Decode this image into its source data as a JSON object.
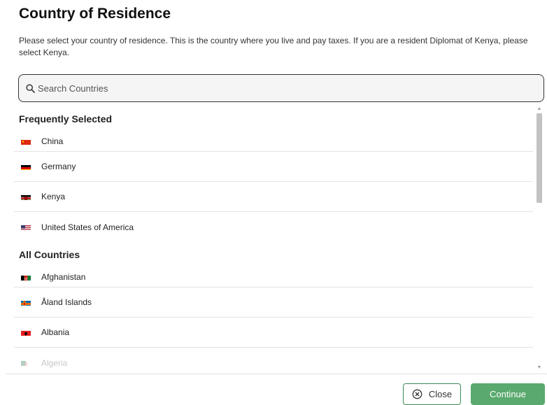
{
  "header": {
    "title": "Country of Residence",
    "description": "Please select your country of residence. This is the country where you live and pay taxes. If you are a resident Diplomat of Kenya, please select Kenya."
  },
  "search": {
    "placeholder": "Search Countries",
    "icon": "search-icon"
  },
  "frequent": {
    "heading": "Frequently Selected",
    "items": [
      {
        "label": "China",
        "flag": "china-flag"
      },
      {
        "label": "Germany",
        "flag": "germany-flag"
      },
      {
        "label": "Kenya",
        "flag": "kenya-flag"
      },
      {
        "label": "United States of America",
        "flag": "usa-flag"
      }
    ]
  },
  "all": {
    "heading": "All Countries",
    "items": [
      {
        "label": "Afghanistan",
        "flag": "afghanistan-flag"
      },
      {
        "label": "Åland Islands",
        "flag": "aland-islands-flag"
      },
      {
        "label": "Albania",
        "flag": "albania-flag"
      },
      {
        "label": "Algeria",
        "flag": "algeria-flag"
      }
    ]
  },
  "buttons": {
    "close_label": "Close",
    "continue_label": "Continue"
  },
  "colors": {
    "accent": "#5aa96e",
    "border_accent": "#3d8b56"
  }
}
